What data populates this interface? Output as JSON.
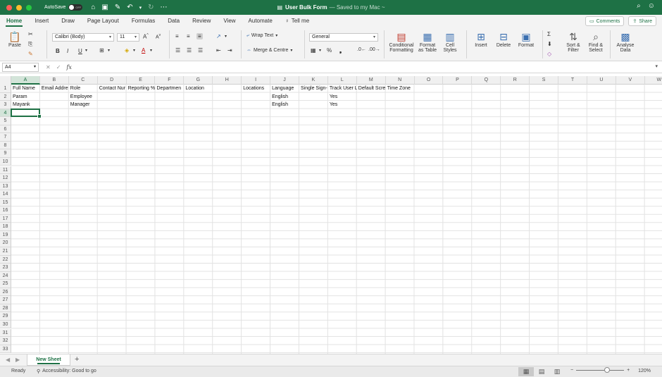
{
  "window": {
    "autosave_label": "AutoSave",
    "autosave_state": "OFF",
    "doc_title": "User Bulk Form",
    "doc_status": "— Saved to my Mac ~"
  },
  "tabs": {
    "items": [
      "Home",
      "Insert",
      "Draw",
      "Page Layout",
      "Formulas",
      "Data",
      "Review",
      "View",
      "Automate"
    ],
    "active": "Home",
    "tell_me": "Tell me",
    "comments": "Comments",
    "share": "Share"
  },
  "ribbon": {
    "paste": "Paste",
    "font_name": "Calibri (Body)",
    "font_size": "11",
    "bold": "B",
    "italic": "I",
    "underline": "U",
    "wrap_text": "Wrap Text",
    "merge_centre": "Merge & Centre",
    "number_format": "General",
    "conditional_formatting": [
      "Conditional",
      "Formatting"
    ],
    "format_as_table": [
      "Format",
      "as Table"
    ],
    "cell_styles": [
      "Cell",
      "Styles"
    ],
    "insert": "Insert",
    "delete": "Delete",
    "format": "Format",
    "sort_filter": [
      "Sort &",
      "Filter"
    ],
    "find_select": [
      "Find &",
      "Select"
    ],
    "analyse_data": [
      "Analyse",
      "Data"
    ]
  },
  "formula_bar": {
    "name_box": "A4",
    "fx": "fx",
    "value": ""
  },
  "grid": {
    "columns": [
      "A",
      "B",
      "C",
      "D",
      "E",
      "F",
      "G",
      "H",
      "I",
      "J",
      "K",
      "L",
      "M",
      "N",
      "O",
      "P",
      "Q",
      "R",
      "S",
      "T",
      "U",
      "V",
      "W"
    ],
    "row_count": 33,
    "selected_column": "A",
    "selected_row": 4,
    "rows": [
      [
        "Full Name",
        "Email Addre",
        "Role",
        "Contact Nur",
        "Reporting %",
        "Departmen",
        "Location",
        "",
        "Locations",
        "Language",
        "Single Sign-",
        "Track User L",
        "Default Scre",
        "Time Zone"
      ],
      [
        "Param",
        "",
        "Employee",
        "",
        "",
        "",
        "",
        "",
        "",
        "English",
        "",
        "Yes",
        "",
        ""
      ],
      [
        "Mayank",
        "",
        "Manager",
        "",
        "",
        "",
        "",
        "",
        "",
        "English",
        "",
        "Yes",
        "",
        ""
      ]
    ]
  },
  "sheets": {
    "active": "New Sheet"
  },
  "status": {
    "ready": "Ready",
    "accessibility": "Accessibility: Good to go",
    "zoom": "120%",
    "zoom_level": 0.64
  }
}
